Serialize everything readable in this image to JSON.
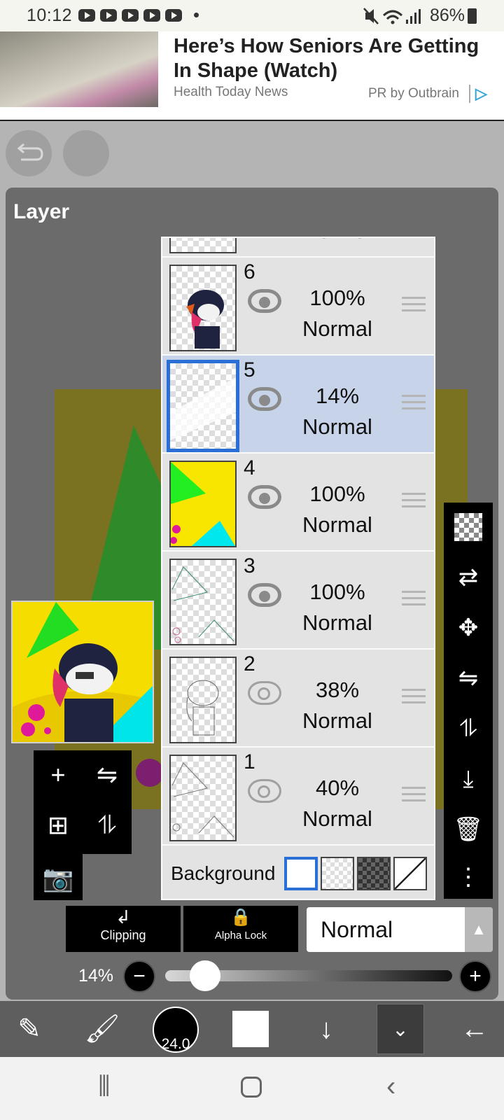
{
  "status_bar": {
    "time": "10:12",
    "battery": "86%"
  },
  "ad": {
    "headline": "Here’s How Seniors Are Getting In Shape (Watch)",
    "source": "Health Today News",
    "sponsor": "PR by Outbrain"
  },
  "panel": {
    "title": "Layer"
  },
  "layers": [
    {
      "number": "6",
      "opacity": "100%",
      "blend": "Normal",
      "visible": true,
      "selected": false
    },
    {
      "number": "5",
      "opacity": "14%",
      "blend": "Normal",
      "visible": true,
      "selected": true
    },
    {
      "number": "4",
      "opacity": "100%",
      "blend": "Normal",
      "visible": true,
      "selected": false
    },
    {
      "number": "3",
      "opacity": "100%",
      "blend": "Normal",
      "visible": true,
      "selected": false
    },
    {
      "number": "2",
      "opacity": "38%",
      "blend": "Normal",
      "visible": false,
      "selected": false
    },
    {
      "number": "1",
      "opacity": "40%",
      "blend": "Normal",
      "visible": false,
      "selected": false
    }
  ],
  "partial_top_layer_blend": "Normal",
  "background_row": {
    "label": "Background"
  },
  "bottom_controls": {
    "clipping_label": "Clipping",
    "alpha_lock_label": "Alpha Lock",
    "blend_mode_value": "Normal",
    "opacity_label": "14%",
    "opacity_value": 0.14
  },
  "toolbar": {
    "brush_size": "24.0"
  },
  "colors": {
    "accent_selected": "#2a6fd6",
    "selected_row": "#c6d3e8",
    "panel_bg": "#6b6b6b"
  }
}
